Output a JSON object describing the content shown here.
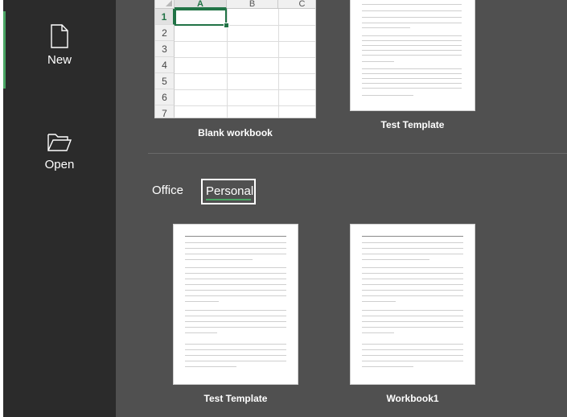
{
  "sidebar": {
    "items": [
      {
        "label": "New",
        "icon": "new-document-icon",
        "active": true
      },
      {
        "label": "Open",
        "icon": "folder-open-icon",
        "active": false
      }
    ]
  },
  "blank_workbook": {
    "columns": [
      "A",
      "B",
      "C"
    ],
    "rows": [
      "1",
      "2",
      "3",
      "4",
      "5",
      "6",
      "7"
    ],
    "caption": "Blank workbook"
  },
  "top_templates": [
    {
      "caption": "Test Template"
    }
  ],
  "tabs": [
    {
      "label": "Office",
      "selected": false
    },
    {
      "label": "Personal",
      "selected": true
    }
  ],
  "personal_templates": [
    {
      "caption": "Test Template"
    },
    {
      "caption": "Workbook1"
    }
  ],
  "colors": {
    "accent": "#217346",
    "active_indicator": "#4aa564",
    "sidebar_bg": "#2b2b2b",
    "main_bg": "#505050"
  }
}
